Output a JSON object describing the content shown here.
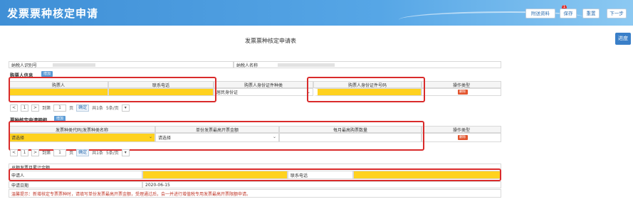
{
  "app": {
    "title": "发票票种核定申请"
  },
  "toolbar": {
    "badge": "1",
    "attach_label": "附送资料",
    "save_label": "保存",
    "reset_label": "重置",
    "next_label": "下一步"
  },
  "side": {
    "progress_label": "进度"
  },
  "form": {
    "title": "发票票种核定申请表"
  },
  "taxpayer": {
    "id_label": "纳税人识别号",
    "name_label": "纳税人名称"
  },
  "buyer": {
    "section_title": "购票人信息",
    "add_label": "增加",
    "headers": [
      "购票人",
      "联系电话",
      "购票人身份证件种类",
      "购票人身份证件号码",
      "操作类型"
    ],
    "id_type_value": "居民身份证",
    "delete_label": "删除"
  },
  "pager1": {
    "prev": "<",
    "page": "1",
    "next": ">",
    "goto": "到第",
    "page_input": "1",
    "page_unit": "页",
    "confirm": "确定",
    "total": "共1条",
    "per_page": "5条/页"
  },
  "invoice": {
    "section_title": "票种核定申请明细",
    "add_label": "增加",
    "headers": [
      "发票种类代码|发票种类名称",
      "单份发票最高开票金额",
      "每月最高购票数量",
      "操作类型"
    ],
    "type_value": "请选择",
    "amount_value": "请选择",
    "delete_label": "删除"
  },
  "pager2": {
    "prev": "<",
    "page": "1",
    "next": ">",
    "goto": "到第",
    "page_input": "1",
    "page_unit": "页",
    "confirm": "确定",
    "total": "共1条",
    "per_page": "5条/页"
  },
  "applicant": {
    "cap_label": "总额发票月累计金额",
    "applicant_label": "申请人",
    "phone_label": "联系电话",
    "date_label": "申请日期",
    "date_value": "2020-06-15"
  },
  "notice": "温馨提示：新增核定专票票种时，请填写单份发票最高开票金额，受理通过后，会一并进行增值税专用发票最高开票限额申请。",
  "colors": {
    "accent": "#3f8fd6",
    "highlight": "#ffd21f",
    "outline": "#d92b2b",
    "delete": "#e2552e"
  }
}
